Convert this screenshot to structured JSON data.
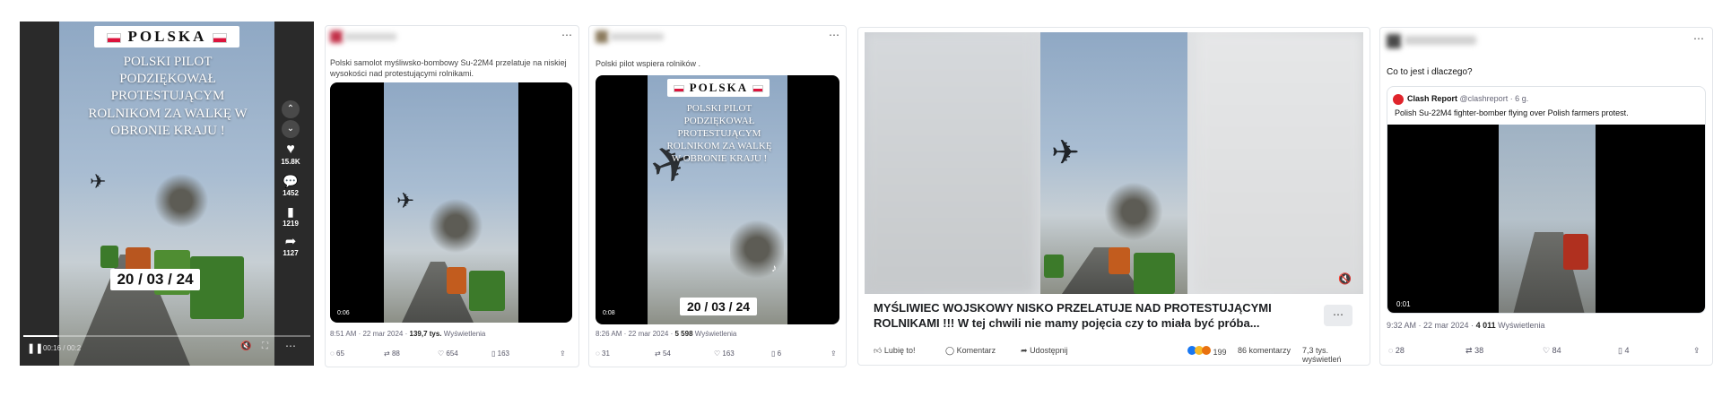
{
  "panel1": {
    "title": "POLSKA",
    "caption": "POLSKI PILOT PODZIĘKOWAŁ PROTESTUJĄCYM ROLNIKOM ZA WALKĘ W OBRONIE KRAJU !",
    "date": "20 / 03 / 24",
    "likes": "15.8K",
    "comments": "1452",
    "saves": "1219",
    "shares": "1127",
    "time": "00:16 / 00:2"
  },
  "panel2": {
    "text": "Polski samolot myśliwsko-bombowy Su-22M4 przelatuje na niskiej wysokości nad protestującymi rolnikami.",
    "duration": "0:06",
    "meta_time": "8:51 AM · 22 mar 2024 · ",
    "views": "139,7 tys.",
    "views_label": " Wyświetlenia",
    "replies": "65",
    "reposts": "88",
    "likes": "654",
    "bookmarks": "163"
  },
  "panel3": {
    "text": "Polski pilot wspiera rolników .",
    "title": "POLSKA",
    "caption": "POLSKI PILOT PODZIĘKOWAŁ PROTESTUJĄCYM ROLNIKOM ZA WALKĘ W OBRONIE KRAJU !",
    "date": "20 / 03 / 24",
    "duration": "0:08",
    "meta_time": "8:26 AM · 22 mar 2024 · ",
    "views": "5 598",
    "views_label": " Wyświetlenia",
    "replies": "31",
    "reposts": "54",
    "likes": "163",
    "bookmarks": "6"
  },
  "panel4": {
    "headline": "MYŚLIWIEC WOJSKOWY NISKO PRZELATUJE NAD PROTESTUJĄCYMI ROLNIKAMI !!! W tej chwili nie mamy pojęcia czy to miała być próba...",
    "like_label": "Lubię to!",
    "comment_label": "Komentarz",
    "share_label": "Udostępnij",
    "reactions": "199",
    "comments": "86 komentarzy",
    "views": "7,3 tys. wyświetleń"
  },
  "panel5": {
    "text": "Co to jest i dlaczego?",
    "quote_author": "Clash Report",
    "quote_handle": "@clashreport · 6 g.",
    "quote_text": "Polish Su-22M4 fighter-bomber flying over Polish farmers protest.",
    "duration": "0:01",
    "meta_time": "9:32 AM · 22 mar 2024 · ",
    "views": "4 011",
    "views_label": " Wyświetlenia",
    "replies": "28",
    "reposts": "38",
    "likes": "84",
    "bookmarks": "4"
  },
  "colors": {
    "flag_red": "#dc143c",
    "twitter_blue": "#1d9bf0",
    "fb_blue": "#1877f2"
  }
}
